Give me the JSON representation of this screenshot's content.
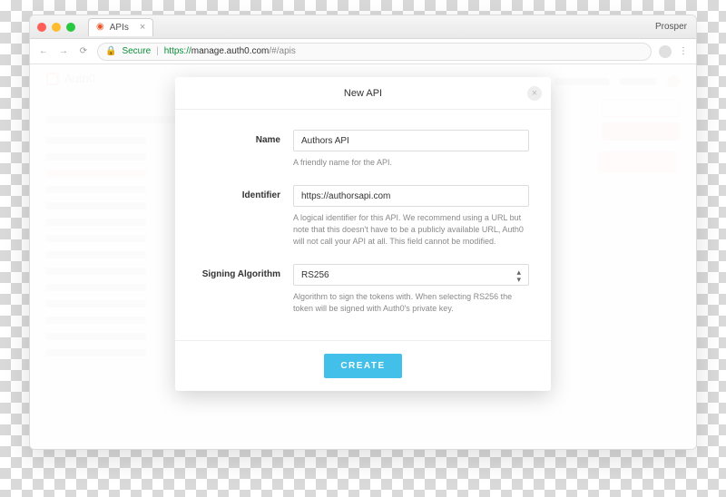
{
  "browser": {
    "tab_title": "APIs",
    "profile": "Prosper",
    "secure_label": "Secure",
    "url_proto": "https://",
    "url_host": "manage.auth0.com",
    "url_path": "/#/apis"
  },
  "brand": "Auth0",
  "modal": {
    "title": "New API",
    "name": {
      "label": "Name",
      "value": "Authors API",
      "help": "A friendly name for the API."
    },
    "identifier": {
      "label": "Identifier",
      "value": "https://authorsapi.com",
      "help": "A logical identifier for this API. We recommend using a URL but note that this doesn't have to be a publicly available URL, Auth0 will not call your API at all. This field cannot be modified."
    },
    "algo": {
      "label": "Signing Algorithm",
      "value": "RS256",
      "help": "Algorithm to sign the tokens with. When selecting RS256 the token will be signed with Auth0's private key."
    },
    "create": "CREATE"
  }
}
